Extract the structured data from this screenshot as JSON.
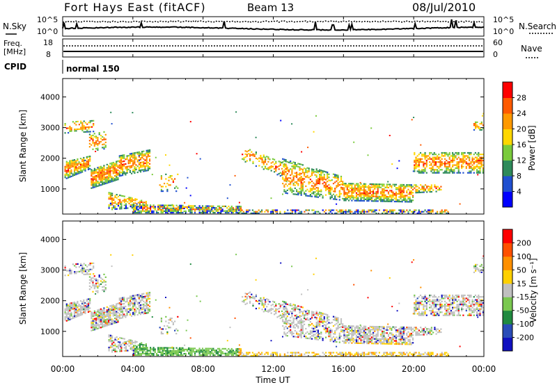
{
  "header": {
    "station": "Fort Hays East (fitACF)",
    "beam": "Beam 13",
    "date": "08/Jul/2010"
  },
  "noise_panel": {
    "left_label": "N.Sky",
    "right_label": "N.Search",
    "ticks_left": [
      "10^5",
      "10^0"
    ],
    "ticks_right": [
      "10^5",
      "10^0"
    ]
  },
  "freq_panel": {
    "left_label_1": "Freq.",
    "left_label_2": "[MHz]",
    "right_label": "Nave",
    "ticks_left": [
      "18",
      "8"
    ],
    "ticks_right": [
      "60",
      "0"
    ]
  },
  "cpid": {
    "label": "CPID",
    "value": "normal 150"
  },
  "x_axis": {
    "ticks": [
      "00:00",
      "04:00",
      "08:00",
      "12:00",
      "16:00",
      "20:00",
      "00:00"
    ],
    "label": "Time UT"
  },
  "chart_data": [
    {
      "type": "heatmap",
      "name": "power",
      "ylabel": "Slant Range [km]",
      "yticks": [
        "1000",
        "2000",
        "3000",
        "4000"
      ],
      "colorbar": {
        "label": "Power [dB]",
        "ticks": [
          "4",
          "8",
          "12",
          "16",
          "20",
          "24",
          "28"
        ],
        "colors": [
          "#0000ff",
          "#2050d0",
          "#2e8a5a",
          "#7acb3c",
          "#ffd700",
          "#ff9900",
          "#ff5a00",
          "#ff0000"
        ]
      }
    },
    {
      "type": "heatmap",
      "name": "velocity",
      "ylabel": "Slant Range [km]",
      "yticks": [
        "1000",
        "2000",
        "3000",
        "4000"
      ],
      "colorbar": {
        "label": "Velocity [m s⁻¹]",
        "ticks": [
          "200",
          "100",
          "50",
          "15",
          "-15",
          "-50",
          "-100",
          "-200"
        ],
        "colors": [
          "#1010c0",
          "#2a4cb8",
          "#208a40",
          "#7ac850",
          "#c0c0c0",
          "#ffd000",
          "#ff9000",
          "#ff5000",
          "#ff0000"
        ]
      }
    }
  ]
}
